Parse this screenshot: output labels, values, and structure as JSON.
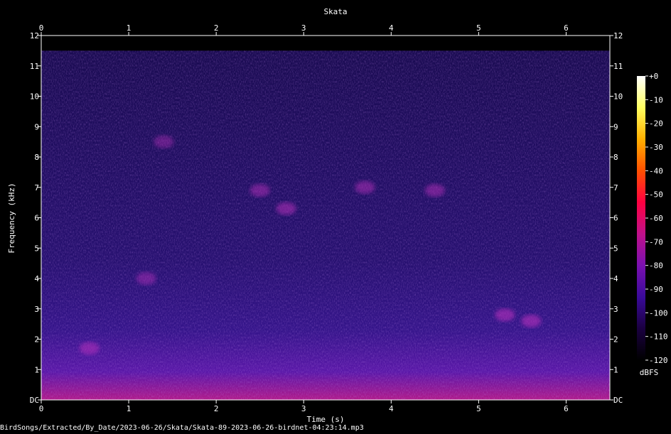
{
  "chart_data": {
    "type": "heatmap",
    "title": "Skata",
    "xlabel": "Time (s)",
    "ylabel": "Frequency (kHz)",
    "xlim": [
      0,
      6.5
    ],
    "ylim": [
      0,
      12
    ],
    "x_ticks": [
      "0",
      "1",
      "2",
      "3",
      "4",
      "5",
      "6"
    ],
    "y_ticks": [
      "DC",
      "1",
      "2",
      "3",
      "4",
      "5",
      "6",
      "7",
      "8",
      "9",
      "10",
      "11",
      "12"
    ],
    "colorbar": {
      "label": "dBFS",
      "range": [
        -120,
        0
      ],
      "ticks": [
        "+0",
        "-10",
        "-20",
        "-30",
        "-40",
        "-50",
        "-60",
        "-70",
        "-80",
        "-90",
        "-100",
        "-110",
        "-120"
      ],
      "colors": [
        "#000000",
        "#1a0040",
        "#3a0a9a",
        "#7a10b0",
        "#c0108a",
        "#ff0040",
        "#ff5000",
        "#ffb000",
        "#ffff60",
        "#ffffff"
      ]
    },
    "energy_cutoff_khz": 11.5,
    "calls": [
      {
        "t": 0.55,
        "f": 1.7,
        "level": -82
      },
      {
        "t": 1.2,
        "f": 4.0,
        "level": -88
      },
      {
        "t": 1.4,
        "f": 8.5,
        "level": -90
      },
      {
        "t": 2.5,
        "f": 6.9,
        "level": -85
      },
      {
        "t": 2.8,
        "f": 6.3,
        "level": -82
      },
      {
        "t": 3.7,
        "f": 7.0,
        "level": -84
      },
      {
        "t": 4.5,
        "f": 6.9,
        "level": -84
      },
      {
        "t": 5.3,
        "f": 2.8,
        "level": -78
      },
      {
        "t": 5.6,
        "f": 2.6,
        "level": -78
      }
    ]
  },
  "footer": {
    "path": "BirdSongs/Extracted/By_Date/2023-06-26/Skata/Skata-89-2023-06-26-birdnet-04:23:14.mp3"
  }
}
